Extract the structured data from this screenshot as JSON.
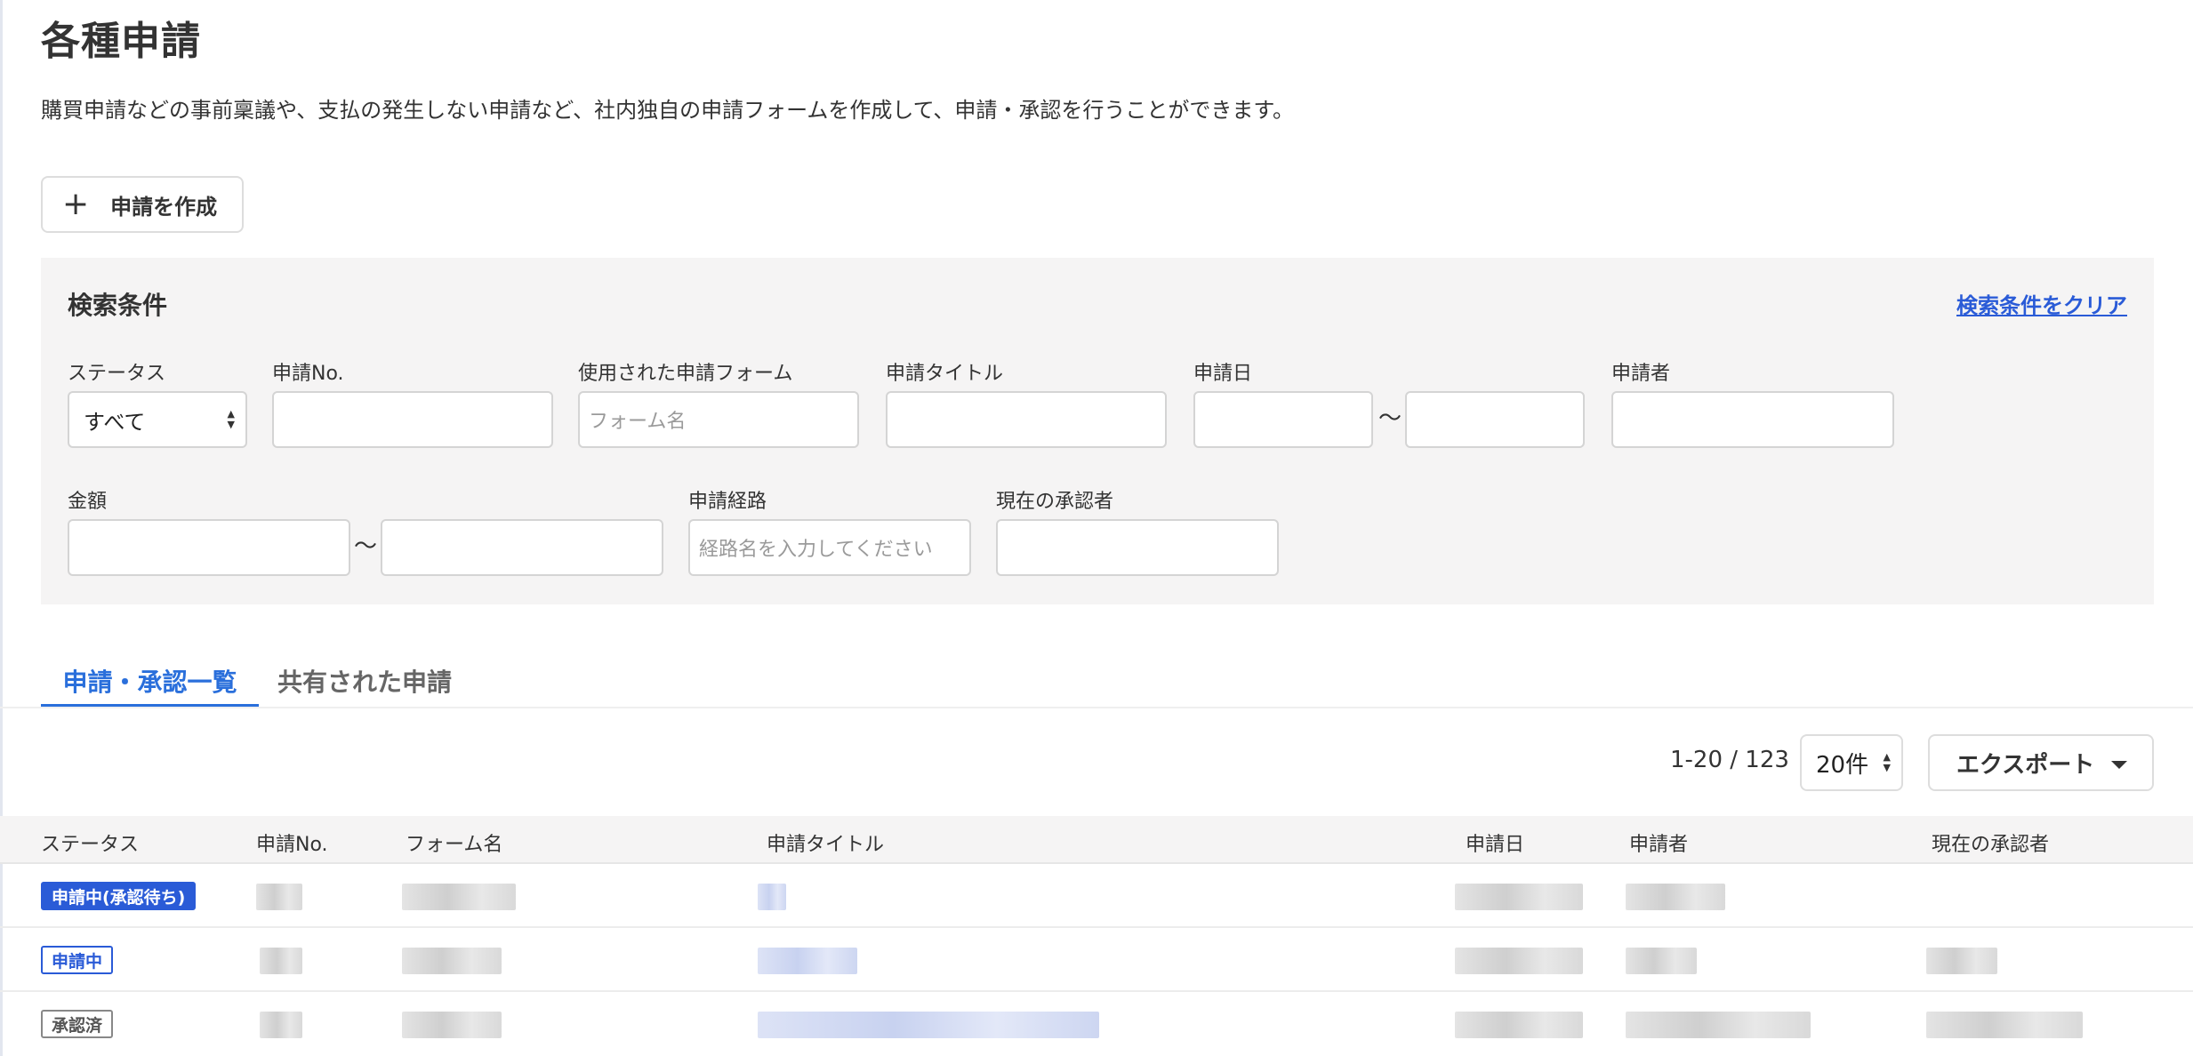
{
  "page": {
    "title": "各種申請",
    "description": "購買申請などの事前稟議や、支払の発生しない申請など、社内独自の申請フォームを作成して、申請・承認を行うことができます。",
    "create_button": "申請を作成"
  },
  "search": {
    "title": "検索条件",
    "clear_link": "検索条件をクリア",
    "tilde": "〜",
    "fields": {
      "status": {
        "label": "ステータス",
        "value": "すべて"
      },
      "number": {
        "label": "申請No.",
        "value": ""
      },
      "form": {
        "label": "使用された申請フォーム",
        "placeholder": "フォーム名"
      },
      "title": {
        "label": "申請タイトル",
        "value": ""
      },
      "date": {
        "label": "申請日",
        "from": "",
        "to": ""
      },
      "applicant": {
        "label": "申請者",
        "value": ""
      },
      "amount": {
        "label": "金額",
        "from": "",
        "to": ""
      },
      "route": {
        "label": "申請経路",
        "placeholder": "経路名を入力してください"
      },
      "approver": {
        "label": "現在の承認者",
        "value": ""
      }
    }
  },
  "tabs": [
    {
      "label": "申請・承認一覧",
      "active": true
    },
    {
      "label": "共有された申請",
      "active": false
    }
  ],
  "pager": {
    "count": "1-20 / 123",
    "per_page": "20件",
    "export": "エクスポート"
  },
  "table": {
    "headers": [
      "ステータス",
      "申請No.",
      "フォーム名",
      "申請タイトル",
      "申請日",
      "申請者",
      "現在の承認者"
    ],
    "rows": [
      {
        "status": "申請中(承認待ち)",
        "status_style": "solid"
      },
      {
        "status": "申請中",
        "status_style": "outline"
      },
      {
        "status": "承認済",
        "status_style": "gray"
      }
    ]
  },
  "colors": {
    "accent": "#2a5bd7",
    "tab_active": "#2a6fdb",
    "panel_bg": "#f5f4f4"
  }
}
